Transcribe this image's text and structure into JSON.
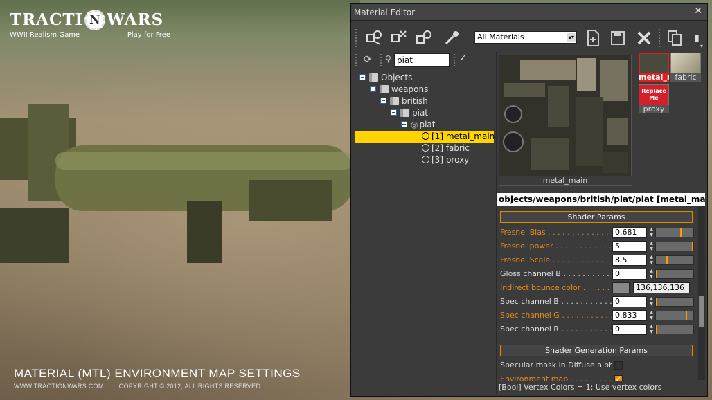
{
  "background": {
    "logo_left": "TRACTI",
    "logo_mid": "N",
    "logo_right": "WARS",
    "logo_sub_left": "WWII Realism Game",
    "logo_sub_right": "Play for Free",
    "caption": "MATERIAL (MTL) ENVIRONMENT MAP SETTINGS",
    "footer_site": "WWW.TRACTIONWARS.COM",
    "footer_copyright": "COPYRIGHT © 2012, ALL RIGHTS RESERVED"
  },
  "window": {
    "title": "Material Editor",
    "close": "✕"
  },
  "toolbar": {
    "material_filter": "All Materials",
    "more": "▾"
  },
  "tree": {
    "search_value": "piat",
    "search_icon": "magnifier-icon",
    "refresh_icon": "refresh-icon",
    "confirm": "✓",
    "nodes": [
      {
        "label": "Objects"
      },
      {
        "label": "weapons"
      },
      {
        "label": "british"
      },
      {
        "label": "piat"
      },
      {
        "label": "piat"
      },
      {
        "label": "[1] metal_main"
      },
      {
        "label": "[2] fabric"
      },
      {
        "label": "[3] proxy"
      }
    ]
  },
  "preview": {
    "big_label": "metal_main",
    "thumbs": [
      {
        "label": "metal_main"
      },
      {
        "label": "fabric"
      },
      {
        "label": "proxy",
        "badge": "Replace Me"
      }
    ]
  },
  "properties": {
    "path": "objects/weapons/british/piat/piat [metal_main]",
    "section_shader": "Shader Params",
    "section_generation": "Shader Generation Params",
    "params": [
      {
        "label": "Fresnel Bias . . . . . . . . . . . . . . . .",
        "value": "0.681",
        "fill": 0.681,
        "orange": true
      },
      {
        "label": "Fresnel power . . . . . . . . . . . . . . .",
        "value": "5",
        "fill": 1.0,
        "orange": true
      },
      {
        "label": "Fresnel Scale . . . . . . . . . . . . . . .",
        "value": "8.5",
        "fill": 0.28,
        "orange": true
      },
      {
        "label": "Gloss channel B . . . . . . . . . . . . . .",
        "value": "0",
        "fill": 0.0,
        "orange": false
      },
      {
        "label": "Indirect bounce color . . . . . . . . .",
        "color_value": "136,136,136",
        "orange": true
      },
      {
        "label": "Spec channel B . . . . . . . . . . . . . .",
        "value": "0",
        "fill": 0.0,
        "orange": false
      },
      {
        "label": "Spec channel G . . . . . . . . . . . . . .",
        "value": "0.833",
        "fill": 0.833,
        "orange": true
      },
      {
        "label": "Spec channel R . . . . . . . . . . . . . .",
        "value": "0",
        "fill": 0.0,
        "orange": false
      }
    ],
    "gen_params": [
      {
        "label": "Specular mask in Diffuse alpha . .",
        "checked": false,
        "orange": false
      },
      {
        "label": "Environment map . . . . . . . . . . . . .",
        "checked": true,
        "orange": true
      }
    ],
    "status": "[Bool] Vertex Colors = 1: Use vertex colors"
  },
  "colors": {
    "accent": "#f28c00",
    "selection": "#ffd400",
    "panel": "#3b3b3b"
  }
}
